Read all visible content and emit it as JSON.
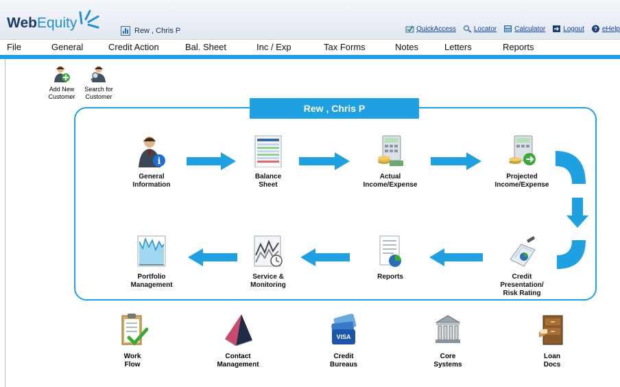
{
  "header": {
    "logo_bold": "Web",
    "logo_light": "Equity",
    "customer": "Rew , Chris P",
    "links": [
      "QuickAccess",
      "Locator",
      "Calculator",
      "Logout",
      "eHelp"
    ]
  },
  "menu": [
    "File",
    "General",
    "Credit Action",
    "Bal. Sheet",
    "Inc / Exp",
    "Tax Forms",
    "Notes",
    "Letters",
    "Reports"
  ],
  "quick_buttons": [
    {
      "line1": "Add New",
      "line2": "Customer"
    },
    {
      "line1": "Search for",
      "line2": "Customer"
    }
  ],
  "panel_title": "Rew , Chris P",
  "workflow": [
    {
      "line1": "General",
      "line2": "Information",
      "line3": ""
    },
    {
      "line1": "Balance",
      "line2": "Sheet",
      "line3": ""
    },
    {
      "line1": "Actual",
      "line2": "Income/Expense",
      "line3": ""
    },
    {
      "line1": "Projected",
      "line2": "Income/Expense",
      "line3": ""
    },
    {
      "line1": "Portfolio",
      "line2": "Management",
      "line3": ""
    },
    {
      "line1": "Service &",
      "line2": "Monitoring",
      "line3": ""
    },
    {
      "line1": "Reports",
      "line2": "",
      "line3": ""
    },
    {
      "line1": "Credit",
      "line2": "Presentation/",
      "line3": "Risk Rating"
    }
  ],
  "bottom": [
    {
      "line1": "Work",
      "line2": "Flow"
    },
    {
      "line1": "Contact",
      "line2": "Management"
    },
    {
      "line1": "Credit",
      "line2": "Bureaus",
      "card_text": "VISA"
    },
    {
      "line1": "Core",
      "line2": "Systems"
    },
    {
      "line1": "Loan",
      "line2": "Docs"
    }
  ],
  "colors": {
    "accent": "#1fa0e1",
    "link": "#1040b0",
    "navy": "#1a3a6b"
  }
}
